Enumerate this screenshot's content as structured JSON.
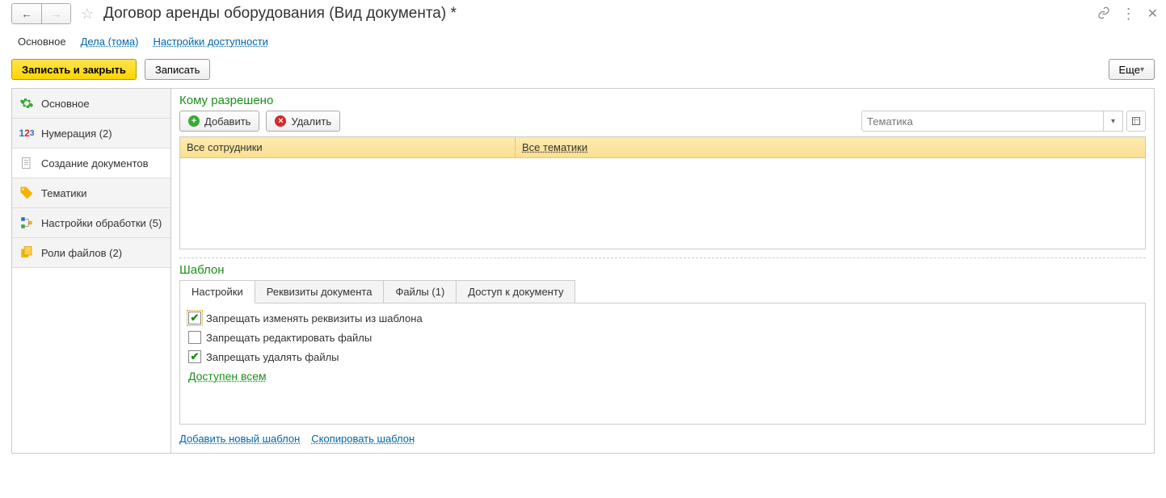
{
  "title": "Договор аренды оборудования (Вид документа) *",
  "topTabs": {
    "main": "Основное",
    "cases": "Дела (тома)",
    "access": "Настройки доступности"
  },
  "toolbar": {
    "saveClose": "Записать и закрыть",
    "save": "Записать",
    "more": "Еще"
  },
  "sidebar": {
    "main": "Основное",
    "numbering": "Нумерация (2)",
    "createDocs": "Создание документов",
    "topics": "Тематики",
    "processing": "Настройки обработки (5)",
    "fileRoles": "Роли файлов (2)"
  },
  "allowedSection": {
    "title": "Кому разрешено",
    "add": "Добавить",
    "delete": "Удалить",
    "filterPlaceholder": "Тематика",
    "row": {
      "col1": "Все сотрудники",
      "col2": "Все тематики"
    }
  },
  "templateSection": {
    "title": "Шаблон",
    "tabs": {
      "settings": "Настройки",
      "attrs": "Реквизиты документа",
      "files": "Файлы (1)",
      "access": "Доступ к документу"
    },
    "checks": {
      "forbidAttrs": "Запрещать изменять реквизиты из шаблона",
      "forbidEditFiles": "Запрещать редактировать файлы",
      "forbidDeleteFiles": "Запрещать удалять файлы"
    },
    "availableAll": "Доступен всем",
    "addNew": "Добавить новый шаблон",
    "copy": "Скопировать шаблон"
  }
}
